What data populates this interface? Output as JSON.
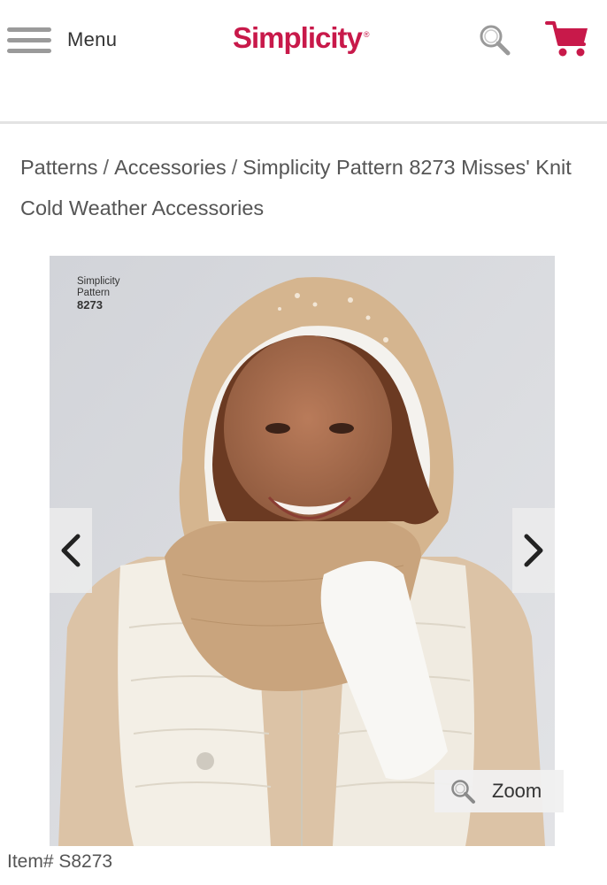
{
  "header": {
    "menu_label": "Menu",
    "logo_text": "Simplicity",
    "logo_mark": "®",
    "icons": [
      "hamburger-menu-icon",
      "search-icon",
      "shopping-cart-icon"
    ],
    "brand_color": "#c8194a"
  },
  "breadcrumb": {
    "items": [
      "Patterns",
      "Accessories",
      "Simplicity Pattern 8273 Misses' Knit Cold Weather Accessories"
    ],
    "separator": "/"
  },
  "product_image": {
    "label_brand": "Simplicity",
    "label_word": "Pattern",
    "label_number": "8273",
    "icons": [
      "chevron-left-icon",
      "chevron-right-icon",
      "zoom-icon"
    ]
  },
  "zoom": {
    "label": "Zoom"
  },
  "item": {
    "number": "Item# S8273"
  }
}
